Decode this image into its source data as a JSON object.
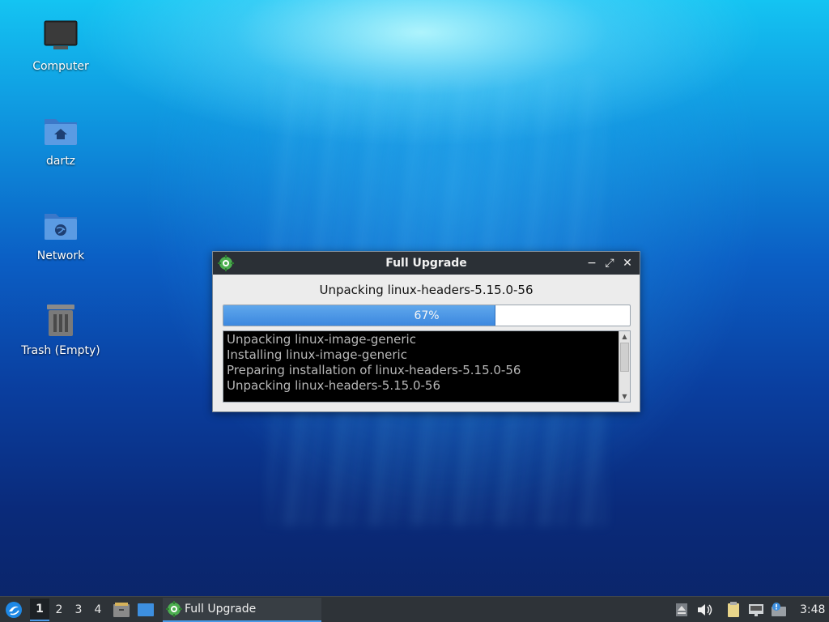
{
  "desktop": {
    "icons": [
      {
        "label": "Computer",
        "icon": "computer-monitor-icon"
      },
      {
        "label": "dartz",
        "icon": "home-folder-icon"
      },
      {
        "label": "Network",
        "icon": "network-folder-icon"
      },
      {
        "label": "Trash (Empty)",
        "icon": "trash-icon"
      }
    ]
  },
  "window": {
    "title": "Full Upgrade",
    "status": "Unpacking linux-headers-5.15.0-56",
    "progress": {
      "percent": 67,
      "label": "67%"
    },
    "log_lines": [
      "Unpacking linux-image-generic",
      "Installing linux-image-generic",
      "Preparing installation of linux-headers-5.15.0-56",
      "Unpacking linux-headers-5.15.0-56"
    ],
    "controls": {
      "minimize": "−",
      "maximize": "⤢",
      "close": "✕"
    }
  },
  "taskbar": {
    "workspaces": [
      "1",
      "2",
      "3",
      "4"
    ],
    "active_workspace": "1",
    "task_label": "Full Upgrade",
    "clock": "3:48",
    "colors": {
      "accent": "#4a9ae8",
      "panel": "#2e3338"
    }
  }
}
